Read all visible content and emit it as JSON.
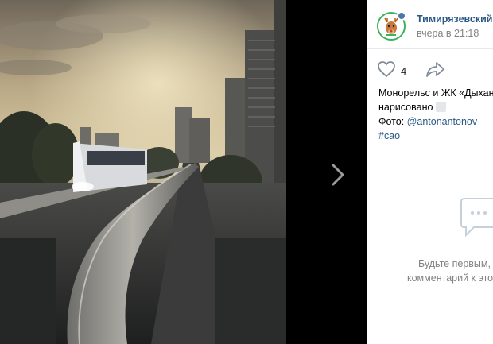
{
  "post": {
    "group_name": "Тимирязевский В",
    "time": "вчера в 21:18",
    "likes": "4",
    "text_line1": "Монорельс и ЖК «Дыхан",
    "text_line2": "нарисовано",
    "photo_label": "Фото: ",
    "photo_author": "@antonantonov",
    "hashtag": "#сао"
  },
  "comments": {
    "empty_line1": "Будьте первым,",
    "empty_line2": "комментарий к это"
  },
  "colors": {
    "link": "#2a5885",
    "muted": "#828282"
  },
  "icons": {
    "like": "heart-icon",
    "share": "share-arrow-icon",
    "next": "chevron-right-icon",
    "comments": "comment-bubble-icon",
    "avatar": "deer-avatar"
  }
}
